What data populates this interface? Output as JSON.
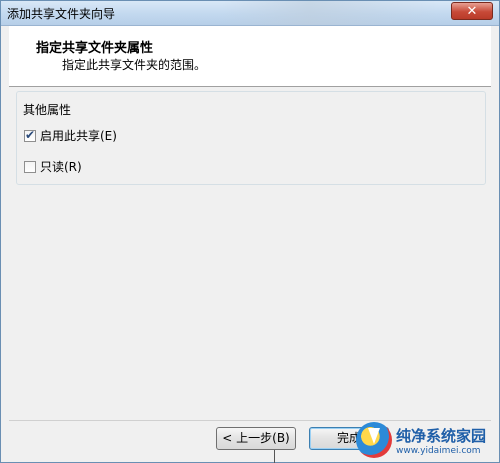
{
  "window": {
    "title": "添加共享文件夹向导",
    "close_glyph": "✕"
  },
  "header": {
    "title": "指定共享文件夹属性",
    "subtitle": "指定此共享文件夹的范围。"
  },
  "group": {
    "label": "其他属性",
    "options": [
      {
        "label": "启用此共享(E)",
        "checked": true
      },
      {
        "label": "只读(R)",
        "checked": false
      }
    ]
  },
  "footer": {
    "back_label": "< 上一步(B)",
    "finish_label": "完成"
  },
  "watermark": {
    "name": "纯净系统家园",
    "url": "www.yidaimei.com"
  },
  "colors": {
    "title_bar": "#c2d8ef",
    "close": "#c74a38",
    "watermark": "#1f5fa8"
  }
}
